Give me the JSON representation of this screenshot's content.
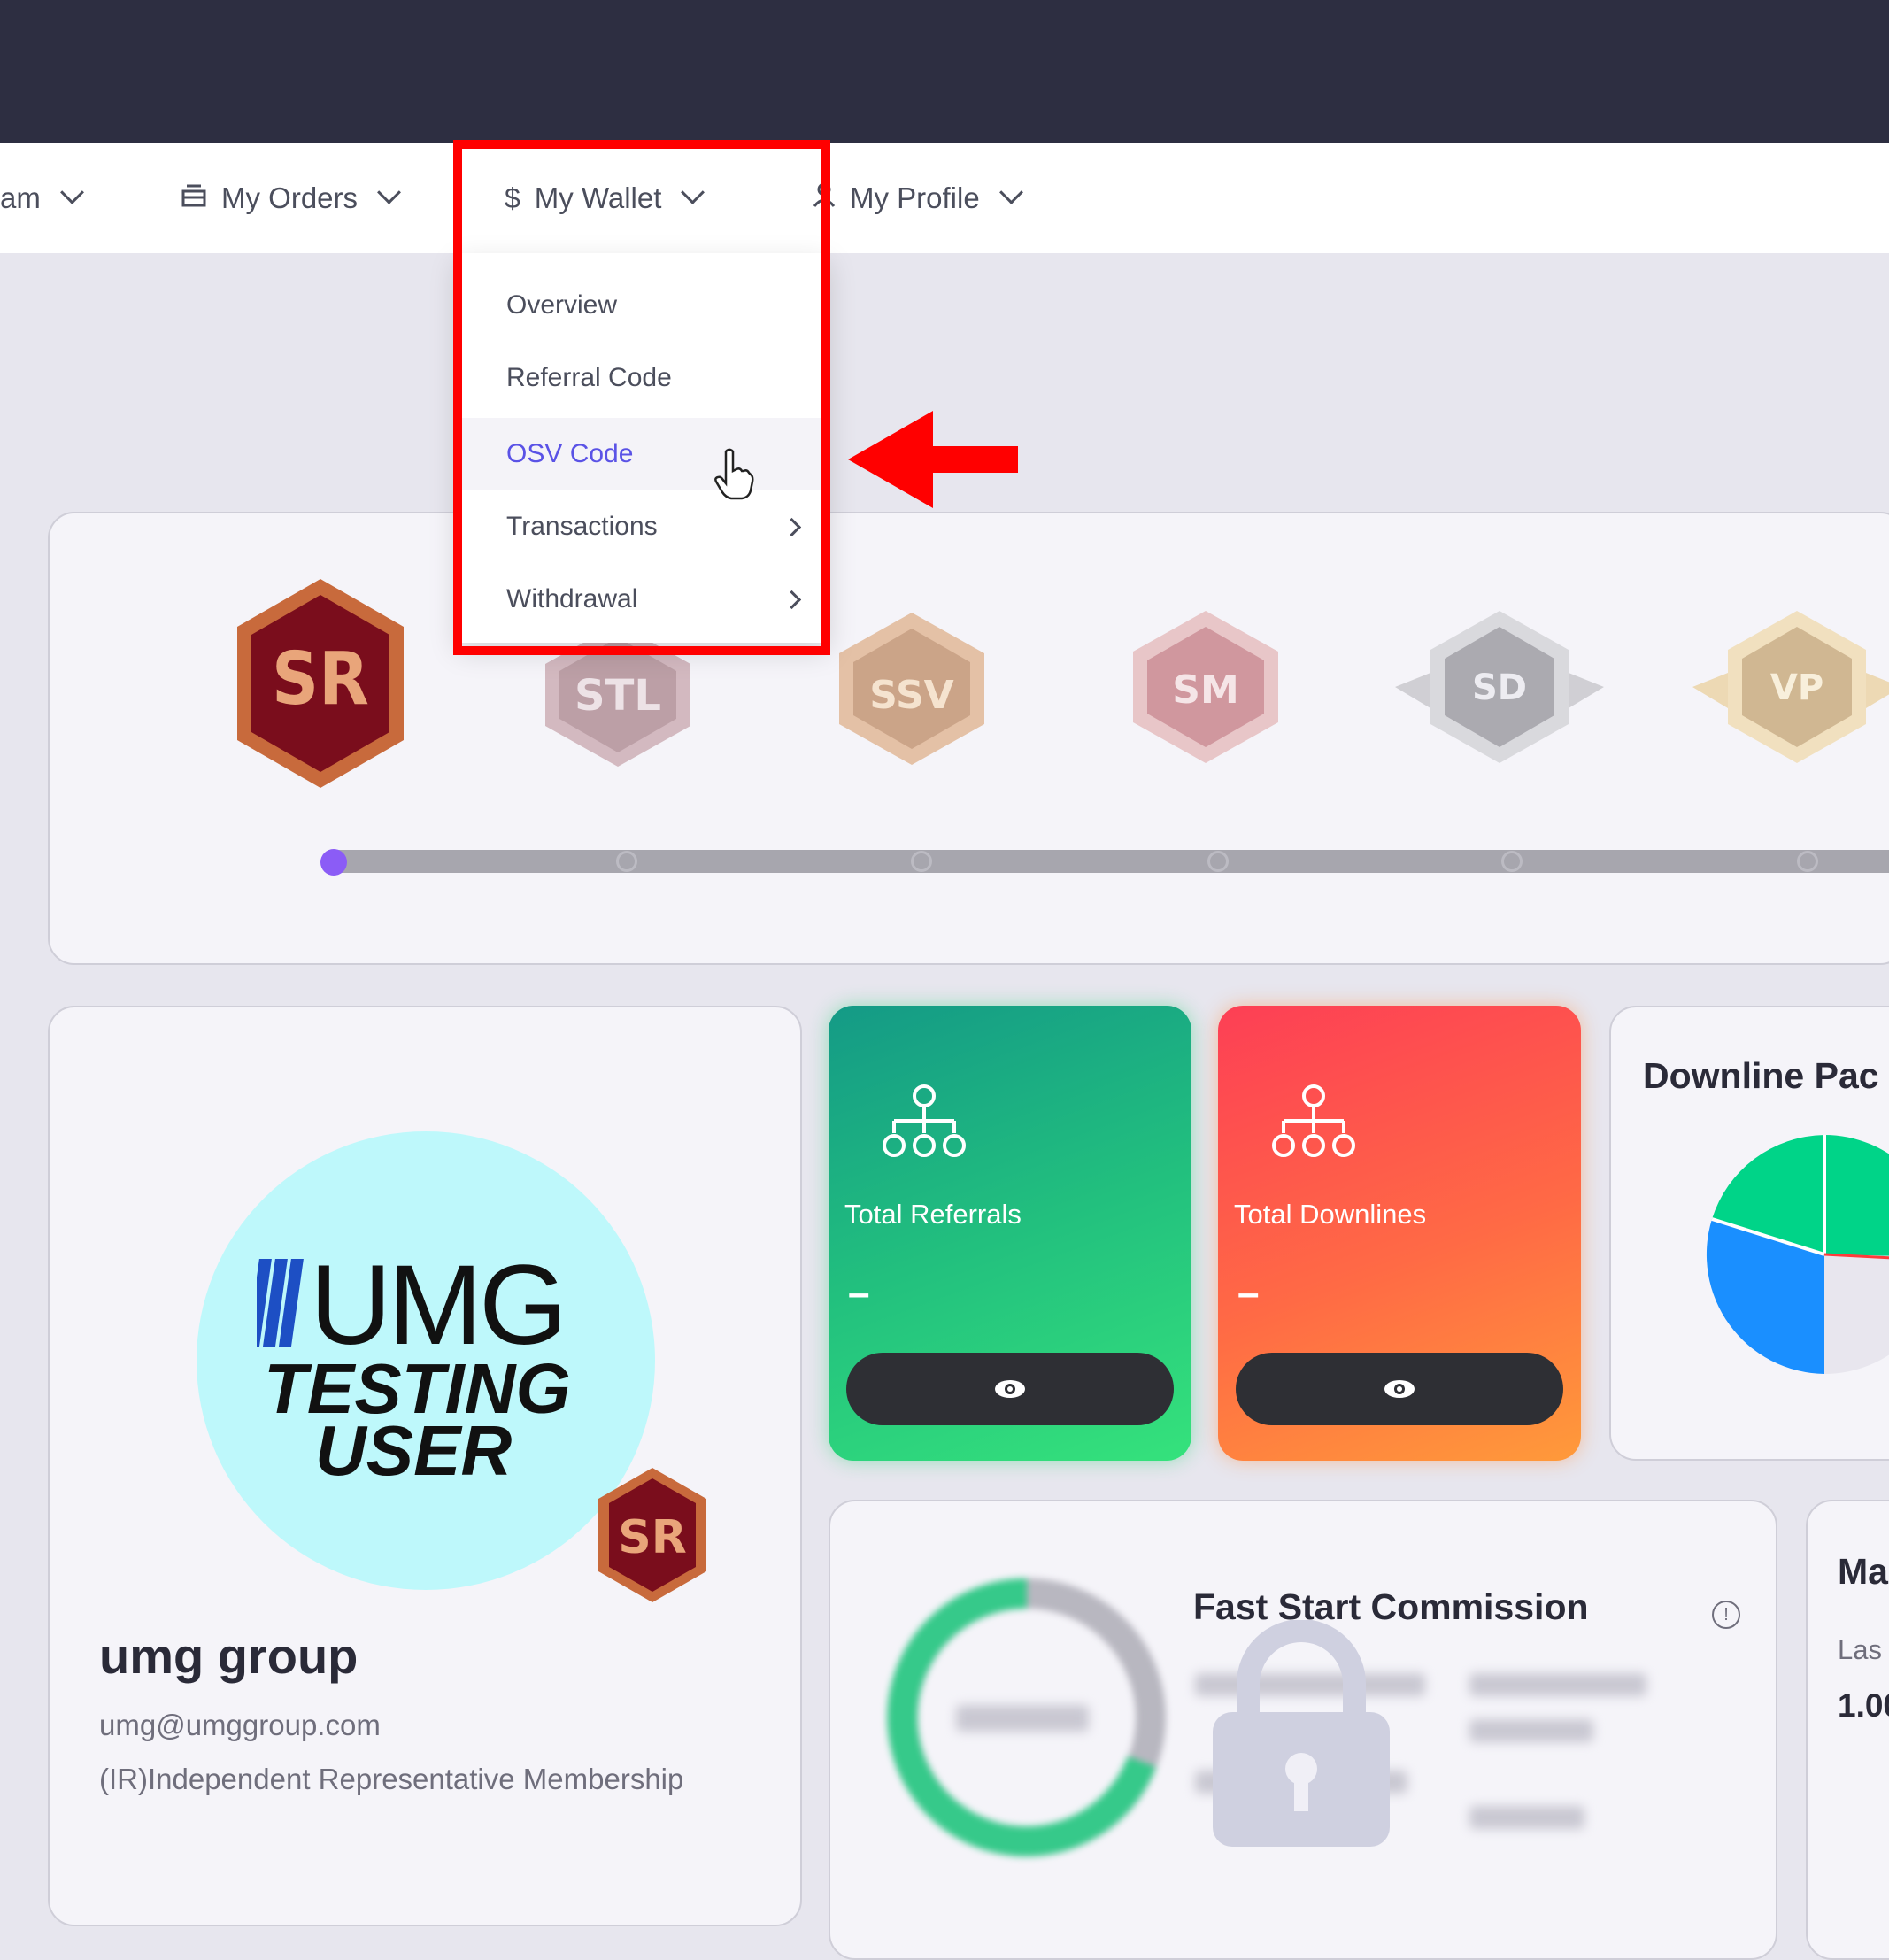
{
  "nav": {
    "items": [
      {
        "label": "am",
        "icon": "none"
      },
      {
        "label": "My Orders",
        "icon": "box-icon"
      },
      {
        "label": "My Wallet",
        "icon": "dollar-icon"
      },
      {
        "label": "My Profile",
        "icon": "user-icon"
      }
    ]
  },
  "wallet_menu": {
    "items": [
      {
        "label": "Overview"
      },
      {
        "label": "Referral Code"
      },
      {
        "label": "OSV Code",
        "active": true
      },
      {
        "label": "Transactions",
        "has_submenu": true
      },
      {
        "label": "Withdrawal",
        "has_submenu": true
      }
    ]
  },
  "ranks": {
    "badges": [
      "SR",
      "STL",
      "SSV",
      "SM",
      "SD",
      "VP"
    ],
    "current": "SR"
  },
  "profile": {
    "logo_lines": [
      "UMG",
      "TESTING",
      "USER"
    ],
    "badge": "SR",
    "name": "umg group",
    "email": "umg@umggroup.com",
    "membership": "(IR)Independent Representative Membership"
  },
  "stats": {
    "referrals": {
      "label": "Total Referrals",
      "value": "–"
    },
    "downlines": {
      "label": "Total Downlines",
      "value": "–"
    }
  },
  "downline_panel": {
    "title": "Downline Pac"
  },
  "commission": {
    "title": "Fast Start Commission"
  },
  "right_panel": {
    "title": "Ma",
    "sub": "Las",
    "value": "1.00"
  },
  "colors": {
    "accent": "#5a52e6",
    "progress_active": "#8b5cf6",
    "highlight": "#ff0000",
    "referrals_card": "#22c07e",
    "downlines_card": "#ff6a45"
  }
}
